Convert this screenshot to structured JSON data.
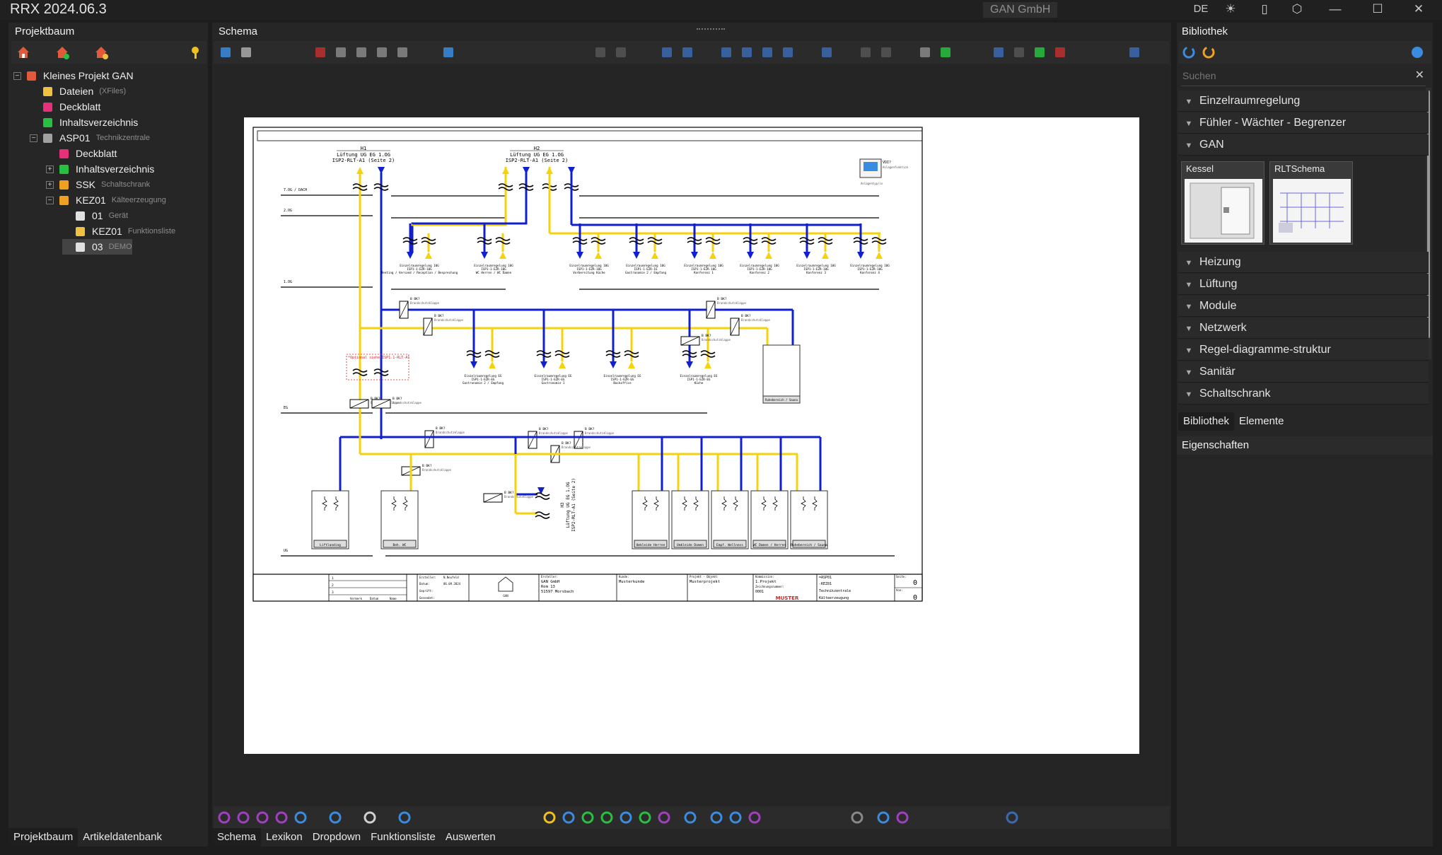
{
  "app": {
    "title": "RRX 2024.06.3",
    "company": "GAN GmbH",
    "lang": "DE"
  },
  "left": {
    "header": "Projektbaum",
    "tree": [
      {
        "label": "Kleines Projekt GAN",
        "sub": "",
        "level": 0,
        "color": "#e25a3a",
        "expander": "−"
      },
      {
        "label": "Dateien",
        "sub": "(XFiles)",
        "level": 1,
        "color": "#f0c040",
        "expander": ""
      },
      {
        "label": "Deckblatt",
        "sub": "",
        "level": 1,
        "color": "#e8307a",
        "expander": ""
      },
      {
        "label": "Inhaltsverzeichnis",
        "sub": "",
        "level": 1,
        "color": "#28c040",
        "expander": ""
      },
      {
        "label": "ASP01",
        "sub": "Technikzentrale",
        "level": 1,
        "color": "#a0a0a0",
        "expander": "−"
      },
      {
        "label": "Deckblatt",
        "sub": "",
        "level": 2,
        "color": "#e8307a",
        "expander": ""
      },
      {
        "label": "Inhaltsverzeichnis",
        "sub": "",
        "level": 2,
        "color": "#28c040",
        "expander": "+"
      },
      {
        "label": "SSK",
        "sub": "Schaltschrank",
        "level": 2,
        "color": "#f0a020",
        "expander": "+"
      },
      {
        "label": "KEZ01",
        "sub": "Kälteerzeugung",
        "level": 2,
        "color": "#f0a020",
        "expander": "−"
      },
      {
        "label": "01",
        "sub": "Gerät",
        "level": 3,
        "color": "#e0e0e0",
        "expander": ""
      },
      {
        "label": "KEZ01",
        "sub": "Funktionsliste",
        "level": 3,
        "color": "#f0c040",
        "expander": ""
      },
      {
        "label": "03",
        "sub": "DEMO",
        "level": 3,
        "color": "#e0e0e0",
        "expander": "",
        "selected": true
      }
    ],
    "tabs": [
      "Projektbaum",
      "Artikeldatenbank"
    ]
  },
  "center": {
    "header": "Schema",
    "tabs": [
      "Schema",
      "Lexikon",
      "Dropdown",
      "Funktionsliste",
      "Auswerten"
    ]
  },
  "schema": {
    "top_blocks": [
      {
        "id": "H1",
        "line1": "Lüftung UG EG 1.OG",
        "line2": "ISP2-RLT-A1 (Seite 2)"
      },
      {
        "id": "H2",
        "line1": "Lüftung UG EG 1.OG",
        "line2": "ISP2-RLT-A1 (Seite 2)"
      }
    ],
    "levels": [
      "7.OG / DACH",
      "2.OG",
      "1.OG",
      "EG",
      "UG"
    ],
    "vdi": [
      "VDI?",
      "Anlagenfunktion",
      "Anlagentyp/in"
    ],
    "rooms_1og": [
      {
        "t": "Einzelraumregelung 10G",
        "s": "ISP1-1-EZR-10G",
        "r": "Meeting / Versand / Reception / Besprechung"
      },
      {
        "t": "Einzelraumregelung 10G",
        "s": "ISP1-1-EZR-10G",
        "r": "WC Herren / WC Damen"
      },
      {
        "t": "Einzelraumregelung 10G",
        "s": "ISP1-1-EZR-10G",
        "r": "Vorbereitung Küche"
      },
      {
        "t": "Einzelraumregelung 10G",
        "s": "ISP1-1-EZR-1G",
        "r": "Gastronomie 2 / Empfang"
      },
      {
        "t": "Einzelraumregelung 10G",
        "s": "ISP1-1-EZR-10G",
        "r": "Konferenz 1"
      },
      {
        "t": "Einzelraumregelung 10G",
        "s": "ISP1-1-EZR-10G",
        "r": "Konferenz 2"
      },
      {
        "t": "Einzelraumregelung 10G",
        "s": "ISP1-1-EZR-10G",
        "r": "Konferenz 3"
      },
      {
        "t": "Einzelraumregelung 10G",
        "s": "ISP1-1-EZR-10G",
        "r": "Konferenz 4"
      }
    ],
    "rooms_eg": [
      {
        "t": "Einzelraumregelung EG",
        "s": "ISP1-1-EZR-EG",
        "r": "Gastronomie 2 / Empfang"
      },
      {
        "t": "Einzelraumregelung EG",
        "s": "ISP1-1-EZR-EG",
        "r": "Gastronomie 1"
      },
      {
        "t": "Einzelraumregelung EG",
        "s": "ISP1-1-EZR-EG",
        "r": "Backoffice"
      },
      {
        "t": "Einzelraumregelung EG",
        "s": "ISP1-1-EZR-EG",
        "r": "Küche"
      }
    ],
    "damper_id": "B BK?",
    "damper_label": "Brandschutzklappe",
    "optional_note": "*Optional siehe ISP1.1-RLT-A1",
    "rooms_ug": [
      "Liftlanding",
      "Beh. WC",
      "Umkleide Herren",
      "Umkleide Damen",
      "Empf. Wellness",
      "WC Damen / Herren",
      "Ruhebereich / Sauna"
    ],
    "room_eg_sauna": "Ruhebereich / Sauna",
    "rotated_ref": {
      "id": "H3",
      "line1": "Lüftung UG EG 1.OG",
      "line2": "ISP2-RLT-A1 (Seite 2)"
    },
    "titleblock": {
      "rows": [
        "1",
        "2",
        "3"
      ],
      "col_labels": [
        "Vermerk",
        "Datum",
        "Name"
      ],
      "ersteller_label": "Ersteller:",
      "ersteller": "N.Neufeld",
      "datum_label": "Datum:",
      "datum": "06.09.2024",
      "geprueft_label": "Geprüft:",
      "gesendet_label": "Gesendet:",
      "firma_label": "Ersteller:",
      "firma": "GAN GmbH",
      "street": "Rom 13",
      "city": "51597 Morsbach",
      "kunde_label": "Kunde:",
      "kunde": "Musterkunde",
      "projekt_label": "Projekt - Objekt:",
      "projekt": "Musterprojekt",
      "kommission_label": "Kommission:",
      "kommission": "1.Projekt",
      "zeichnung_label": "Zeichnungsnummer:",
      "zeichnung": "0001",
      "muster": "MUSTER",
      "ref1": "=ASP01",
      "ref2": "-KEZ01",
      "ref3": "Technikzentrale",
      "ref4": "Kälteerzeugung",
      "seite_label": "Seite:",
      "seite": "0",
      "von_label": "Von:",
      "von": "0",
      "logo": "GAN"
    }
  },
  "right": {
    "header": "Bibliothek",
    "search_placeholder": "Suchen",
    "categories_top": [
      "Einzelraumregelung",
      "Fühler - Wächter - Begrenzer",
      "GAN"
    ],
    "thumbs": [
      "Kessel",
      "RLTSchema"
    ],
    "categories": [
      "Heizung",
      "Lüftung",
      "Module",
      "Netzwerk",
      "Regel-diagramme-struktur",
      "Sanitär",
      "Schaltschrank"
    ],
    "tabs": [
      "Bibliothek",
      "Elemente"
    ],
    "properties": "Eigenschaften"
  },
  "colors": {
    "supply": "#f5d20b",
    "exhaust": "#1020d0",
    "accent": "#3a8ce0"
  }
}
